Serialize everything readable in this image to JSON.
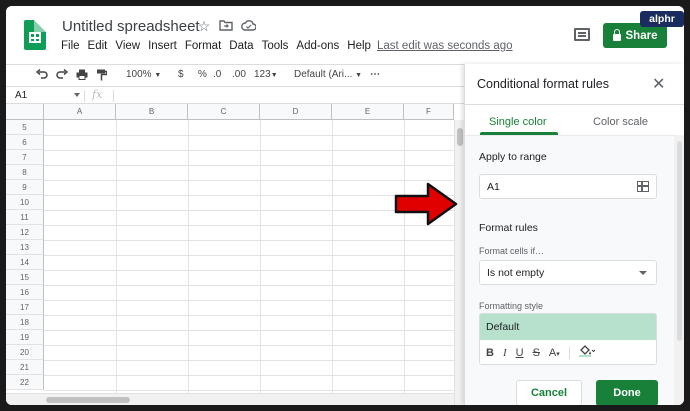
{
  "brand_badge": "alphr",
  "document": {
    "title": "Untitled spreadsheet",
    "title_icons": [
      "star-icon",
      "move-folder-icon",
      "cloud-saved-icon"
    ]
  },
  "menu": [
    "File",
    "Edit",
    "View",
    "Insert",
    "Format",
    "Data",
    "Tools",
    "Add-ons",
    "Help"
  ],
  "last_edit": "Last edit was seconds ago",
  "share_label": "Share",
  "toolbar": {
    "zoom": "100%",
    "currency": "$",
    "percent": "%",
    "decrease_decimals": ".0",
    "increase_decimals": ".00",
    "more_formats": "123",
    "font": "Default (Ari...",
    "more": "⋯"
  },
  "formula_bar": {
    "cell_ref": "A1",
    "fx": "fx"
  },
  "grid": {
    "columns": [
      "A",
      "B",
      "C",
      "D",
      "E",
      "F"
    ],
    "rows": [
      "5",
      "6",
      "7",
      "8",
      "9",
      "10",
      "11",
      "12",
      "13",
      "14",
      "15",
      "16",
      "17",
      "18",
      "19",
      "20",
      "21",
      "22"
    ]
  },
  "panel": {
    "title": "Conditional format rules",
    "tabs": [
      "Single color",
      "Color scale"
    ],
    "active_tab": "Single color",
    "apply_to_range_label": "Apply to range",
    "range_value": "A1",
    "format_rules_label": "Format rules",
    "format_cells_if_label": "Format cells if…",
    "condition_value": "Is not empty",
    "formatting_style_label": "Formatting style",
    "style_preview": "Default",
    "style_tools": [
      "B",
      "I",
      "U",
      "S",
      "A"
    ],
    "cancel_label": "Cancel",
    "done_label": "Done"
  },
  "colors": {
    "accent_green": "#188038",
    "preview_fill": "#b7e1cd",
    "arrow_red": "#e00000"
  }
}
